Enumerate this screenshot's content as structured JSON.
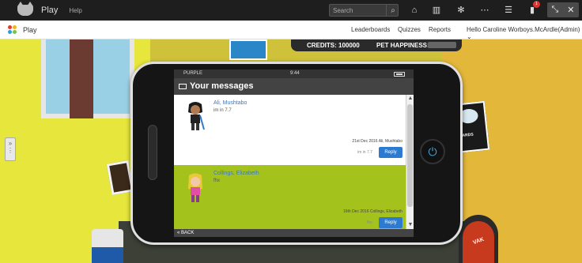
{
  "topbar": {
    "app_name": "Play",
    "help": "Help",
    "search_placeholder": "Search",
    "notifications_count": "1",
    "corner_icons": [
      "⤡",
      "✕"
    ]
  },
  "navbar": {
    "title": "Play",
    "links": [
      "Leaderboards",
      "Quizzes",
      "Reports"
    ],
    "user": "Hello Caroline Worboys.McArdle(Admin) ⌄"
  },
  "credits": {
    "credits_text": "CREDITS: 100000",
    "happiness_text": "PET HAPPINESS:"
  },
  "phone": {
    "carrier": "PURPLE",
    "time": "9:44",
    "header": "Your messages",
    "back": "« BACK",
    "messages": [
      {
        "from": "Ali, Mushtabo",
        "body": "im in 7.7",
        "date": "21st Dec 2016 Ali, Mushtabo",
        "preview": "im in 7.7",
        "reply": "Reply"
      },
      {
        "from": "Collings, Elizabeth",
        "body": "fhx",
        "date": "16th Dec 2016 Collings, Elizabeth",
        "preview": "fhx",
        "reply": "Reply"
      }
    ]
  },
  "room": {
    "poster_text": "BOARDS",
    "robot_text": "VAK"
  },
  "colors": {
    "accent_blue": "#2d7bd0",
    "message_highlight": "#a3c21b",
    "header_dark": "#434343"
  }
}
